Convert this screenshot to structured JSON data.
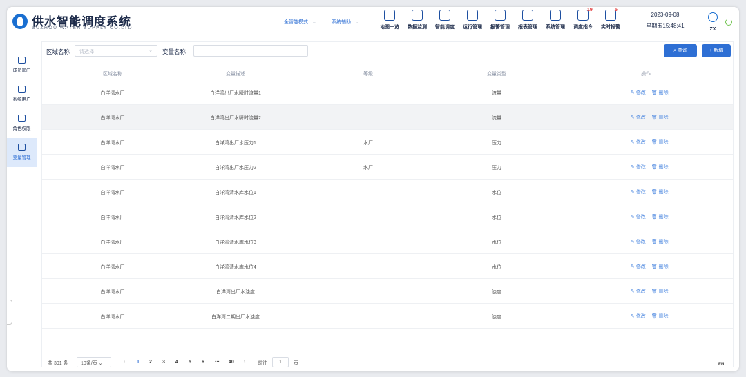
{
  "brand": {
    "title": "供水智能调度系统",
    "subtitle": "SUZHOU WATER SUPPLY CO.LTD"
  },
  "header": {
    "mode_select": "全智能模式",
    "aux_select": "系统辅助",
    "nav": [
      {
        "label": "地图一览",
        "icon": "map-pin-icon"
      },
      {
        "label": "数据监测",
        "icon": "monitor-icon"
      },
      {
        "label": "智能调度",
        "icon": "dispatch-icon"
      },
      {
        "label": "运行管理",
        "icon": "network-icon"
      },
      {
        "label": "报警管理",
        "icon": "alarm-icon"
      },
      {
        "label": "报表管理",
        "icon": "report-icon"
      },
      {
        "label": "系统管理",
        "icon": "gear-icon"
      },
      {
        "label": "调度指令",
        "icon": "flag-icon",
        "badge": "19"
      },
      {
        "label": "实时报警",
        "icon": "bell-icon",
        "badge": "5"
      }
    ],
    "date": "2023-09-08",
    "time": "星期五15:48:41",
    "user": "ZX"
  },
  "sidebar": {
    "items": [
      {
        "label": "成员部门"
      },
      {
        "label": "系统用户"
      },
      {
        "label": "角色权限"
      },
      {
        "label": "变量管理"
      }
    ]
  },
  "filter": {
    "region_label": "区域名称",
    "region_placeholder": "请选择",
    "var_label": "变量名称",
    "var_value": "",
    "search_label": "查询",
    "add_label": "+ 新增"
  },
  "table": {
    "headers": [
      "区域名称",
      "变量描述",
      "等级",
      "变量类型",
      "操作"
    ],
    "edit_label": "修改",
    "delete_label": "删除",
    "rows": [
      [
        "白洋湾水厂",
        "白洋湾出厂水瞬时流量1",
        "",
        "流量"
      ],
      [
        "白洋湾水厂",
        "白洋湾出厂水瞬时流量2",
        "",
        "流量"
      ],
      [
        "白洋湾水厂",
        "白洋湾出厂水压力1",
        "水厂",
        "压力"
      ],
      [
        "白洋湾水厂",
        "白洋湾出厂水压力2",
        "水厂",
        "压力"
      ],
      [
        "白洋湾水厂",
        "白洋湾清水库水位1",
        "",
        "水位"
      ],
      [
        "白洋湾水厂",
        "白洋湾清水库水位2",
        "",
        "水位"
      ],
      [
        "白洋湾水厂",
        "白洋湾清水库水位3",
        "",
        "水位"
      ],
      [
        "白洋湾水厂",
        "白洋湾清水库水位4",
        "",
        "水位"
      ],
      [
        "白洋湾水厂",
        "白洋湾出厂水浊度",
        "",
        "浊度"
      ],
      [
        "白洋湾水厂",
        "白洋湾二期出厂水浊度",
        "",
        "浊度"
      ]
    ]
  },
  "pager": {
    "total": "共 391 条",
    "page_size": "10条/页",
    "pages": [
      "1",
      "2",
      "3",
      "4",
      "5",
      "6",
      "···",
      "40"
    ],
    "goto_label": "前往",
    "goto_value": "1",
    "page_unit": "页"
  },
  "corner_text": "EN"
}
